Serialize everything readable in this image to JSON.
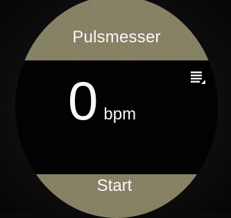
{
  "header": {
    "title": "Pulsmesser"
  },
  "measurement": {
    "value": "0",
    "unit": "bpm"
  },
  "footer": {
    "action_label": "Start"
  },
  "icons": {
    "menu": "menu-icon"
  },
  "colors": {
    "band": "#8a8567",
    "text": "#ffffff",
    "background": "#020202"
  }
}
